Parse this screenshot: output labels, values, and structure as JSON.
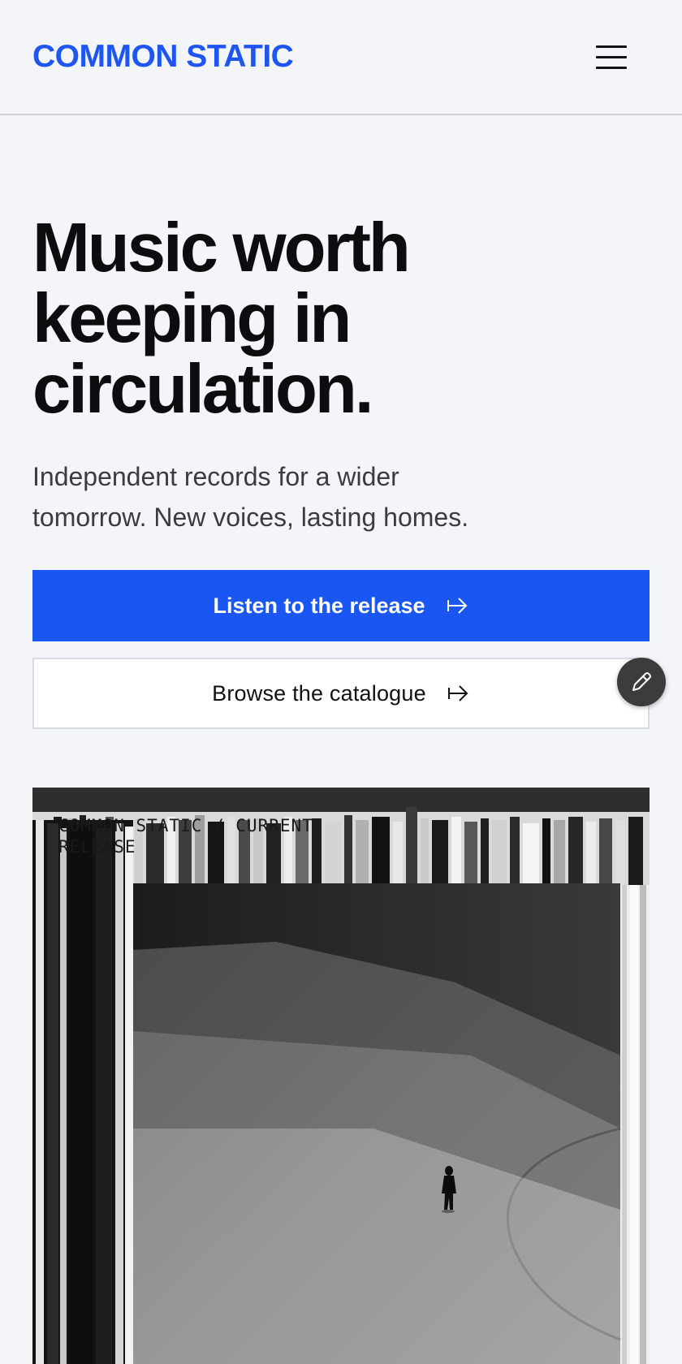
{
  "header": {
    "brand": "COMMON STATIC",
    "menu_icon": "hamburger-menu-icon"
  },
  "hero": {
    "headline": "Music worth keeping in circulation.",
    "subhead": "Independent records for a wider tomorrow. New voices, lasting homes."
  },
  "actions": {
    "primary_label": "Listen to the release",
    "secondary_label": "Browse the catalogue",
    "arrow_icon": "arrow-right-icon"
  },
  "edit_fab": {
    "icon": "pencil-icon"
  },
  "release": {
    "caption": "COMMON STATIC / CURRENT RELEASE"
  },
  "colors": {
    "brand_blue": "#1f56f0",
    "background": "#f4f5f8",
    "text": "#0d0d0f"
  }
}
